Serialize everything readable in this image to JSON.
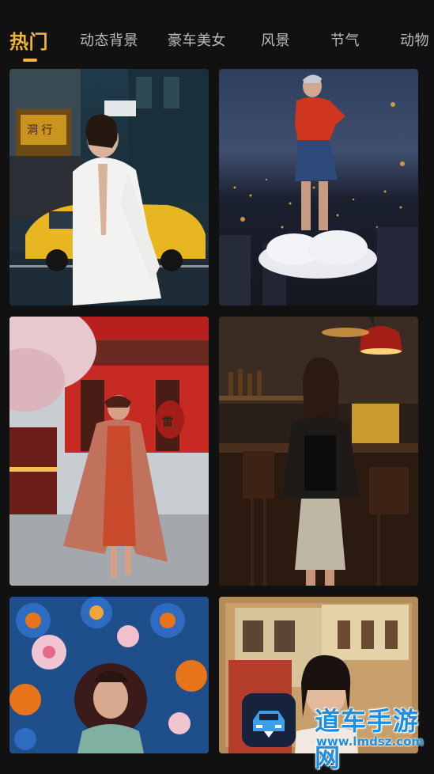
{
  "tabs": [
    {
      "label": "热门",
      "active": true
    },
    {
      "label": "动态背景",
      "active": false
    },
    {
      "label": "豪车美女",
      "active": false
    },
    {
      "label": "风景",
      "active": false
    },
    {
      "label": "节气",
      "active": false
    },
    {
      "label": "动物",
      "active": false
    }
  ],
  "colors": {
    "accent": "#f2b43a",
    "background": "#111111",
    "tab_inactive": "#bdbdbd"
  },
  "cards": [
    {
      "subject": "woman-white-blazer-street-taxi"
    },
    {
      "subject": "woman-red-sweater-on-cloud-city-night"
    },
    {
      "subject": "woman-red-coat-temple-street"
    },
    {
      "subject": "woman-leather-jacket-bar"
    },
    {
      "subject": "woman-flower-mandala"
    },
    {
      "subject": "woman-old-building-sepia"
    }
  ],
  "watermark": {
    "text": "道车手游网",
    "url": "www.lmdsz.com"
  }
}
